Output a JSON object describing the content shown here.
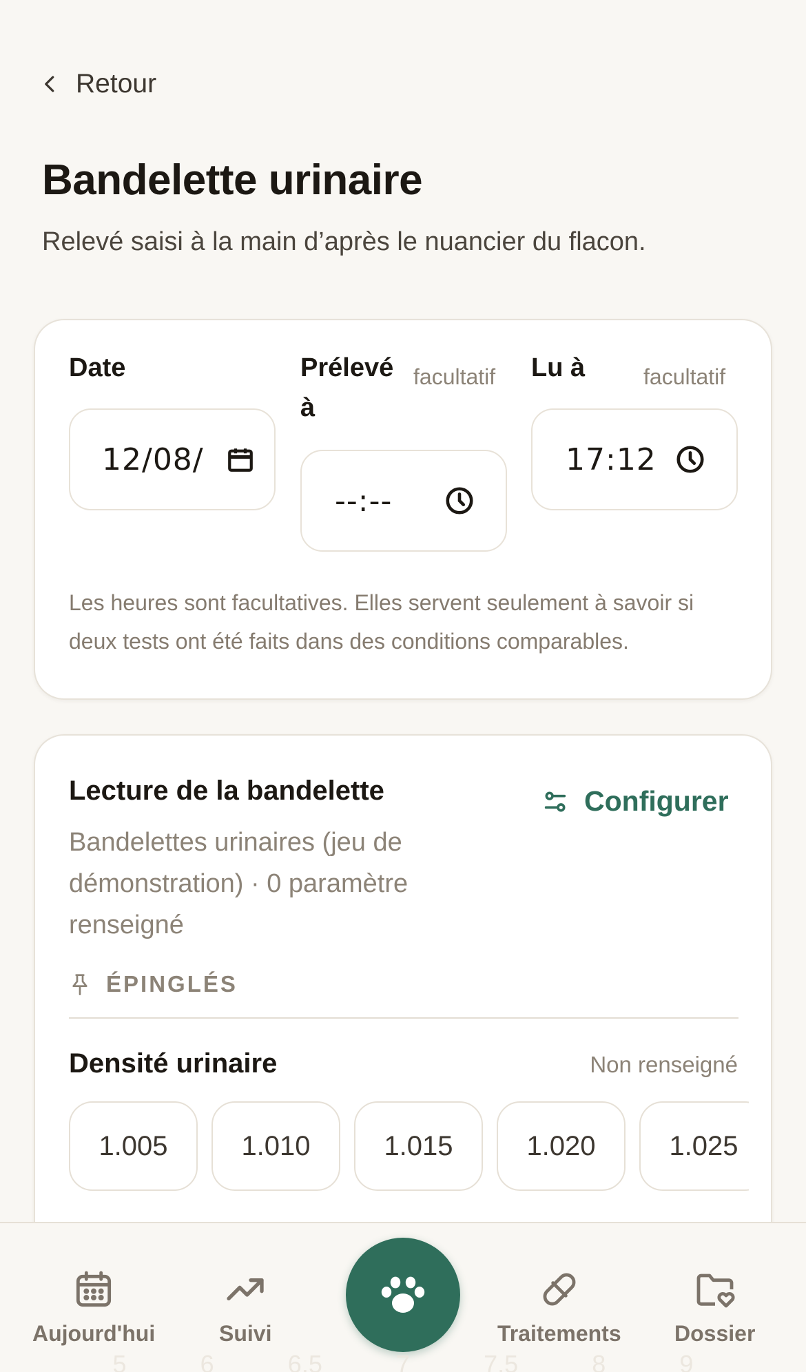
{
  "header": {
    "back_label": "Retour",
    "title": "Bandelette urinaire",
    "subtitle": "Relevé saisi à la main d’après le nuancier du flacon."
  },
  "timing_card": {
    "date": {
      "label": "Date",
      "value": "12/08/"
    },
    "sampled_at": {
      "label": "Prélevé à",
      "optional": "facultatif",
      "value": "--:--"
    },
    "read_at": {
      "label": "Lu à",
      "optional": "facultatif",
      "value": "17:12"
    },
    "help_text": "Les heures sont facultatives. Elles servent seulement à savoir si deux tests ont été faits dans des conditions comparables."
  },
  "reading_card": {
    "title": "Lecture de la bandelette",
    "subtitle": "Bandelettes urinaires (jeu de démonstration) · 0 paramètre renseigné",
    "configure_label": "Configurer",
    "pinned_label": "ÉPINGLÉS",
    "parameter": {
      "name": "Densité urinaire",
      "status": "Non renseigné",
      "options": [
        "1.005",
        "1.010",
        "1.015",
        "1.020",
        "1.025"
      ]
    }
  },
  "bottom_nav": {
    "items": [
      {
        "label": "Aujourd'hui",
        "icon": "calendar-icon"
      },
      {
        "label": "Suivi",
        "icon": "trend-icon"
      },
      {
        "label": "Traitements",
        "icon": "pill-icon"
      },
      {
        "label": "Dossier",
        "icon": "folder-heart-icon"
      }
    ],
    "center_icon": "paw-icon",
    "ghost_scale": [
      "5",
      "6",
      "6.5",
      "7",
      "7.5",
      "8",
      "9"
    ]
  },
  "colors": {
    "background": "#f9f7f3",
    "accent": "#2f6e5b",
    "muted_text": "#8c8377"
  }
}
